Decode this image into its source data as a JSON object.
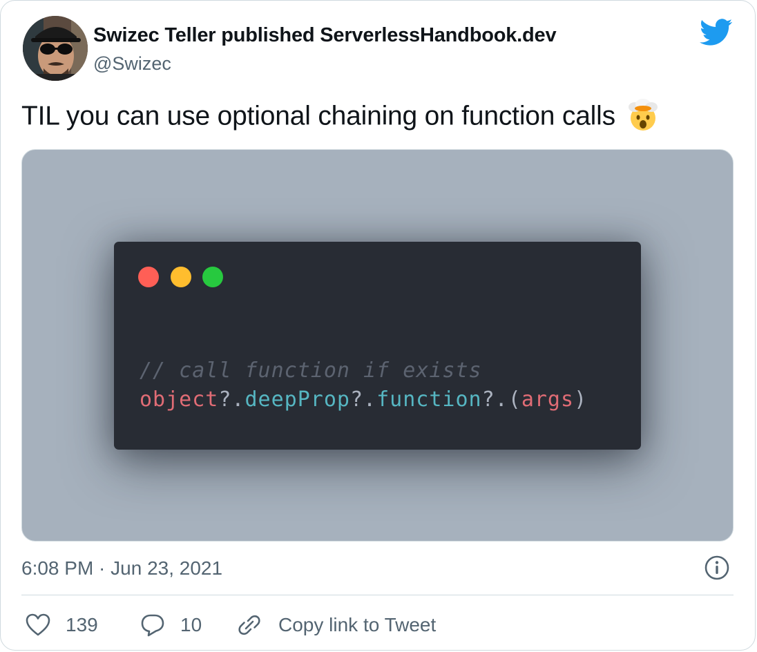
{
  "author": {
    "name": "Swizec Teller published ServerlessHandbook.dev",
    "handle": "@Swizec"
  },
  "tweet": {
    "text": "TIL you can use optional chaining on function calls",
    "emoji": "exploding-head-emoji",
    "timestamp": "6:08 PM · Jun 23, 2021"
  },
  "media": {
    "code_comment": "// call function if exists",
    "code_tokens": [
      {
        "t": "object",
        "c": "red"
      },
      {
        "t": "?.",
        "c": "plain"
      },
      {
        "t": "deepProp",
        "c": "cyan"
      },
      {
        "t": "?.",
        "c": "plain"
      },
      {
        "t": "function",
        "c": "cyan"
      },
      {
        "t": "?.(",
        "c": "plain"
      },
      {
        "t": "args",
        "c": "red"
      },
      {
        "t": ")",
        "c": "plain"
      }
    ]
  },
  "actions": {
    "like_count": "139",
    "reply_count": "10",
    "copy_link_label": "Copy link to Tweet"
  },
  "icons": {
    "brand": "twitter-bird-icon",
    "info": "info-icon",
    "like": "heart-icon",
    "reply": "reply-bubble-icon",
    "copy": "link-icon"
  },
  "colors": {
    "brand": "#1d9bf0",
    "secondary_text": "#536471",
    "code_bg": "#282c34",
    "media_bg": "#a6b1bd"
  }
}
